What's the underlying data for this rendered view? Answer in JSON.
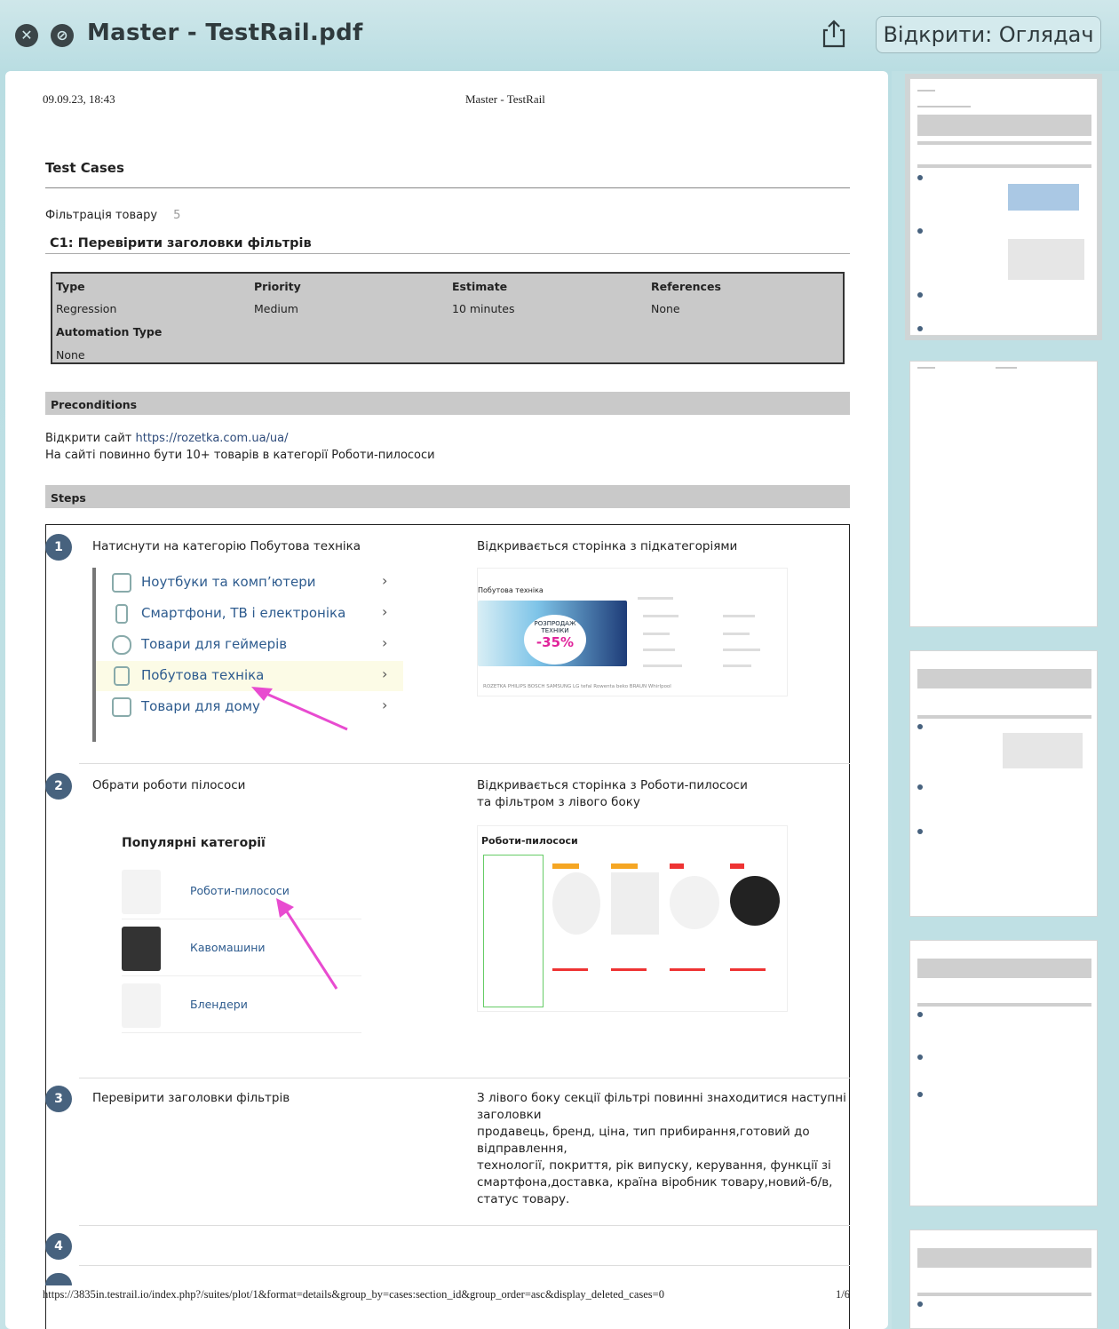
{
  "window": {
    "title": "Master - TestRail.pdf",
    "open_button": "Відкрити: Оглядач",
    "close_icon": "close-icon",
    "markup_icon": "markup-icon",
    "share_icon": "share-icon"
  },
  "page_header": {
    "date": "09.09.23, 18:43",
    "title": "Master - TestRail"
  },
  "doc": {
    "heading": "Test Cases",
    "section": "Фільтрація товару",
    "section_count": "5",
    "case_title": "C1: Перевірити заголовки фільтрів",
    "props": {
      "type_label": "Type",
      "type_value": "Regression",
      "priority_label": "Priority",
      "priority_value": "Medium",
      "estimate_label": "Estimate",
      "estimate_value": "10 minutes",
      "references_label": "References",
      "references_value": "None",
      "automation_label": "Automation Type",
      "automation_value": "None"
    },
    "preconditions_label": "Preconditions",
    "pre_line1_prefix": "Відкрити сайт ",
    "pre_line1_link": "https://rozetka.com.ua/ua/",
    "pre_line2": "На сайті повинно бути 10+ товарів в категорії Роботи-пилососи",
    "steps_label": "Steps",
    "steps": [
      {
        "num": "1",
        "action": "Натиснути на категорію Побутова техніка",
        "expected": "Відкривається сторінка з підкатегоріями"
      },
      {
        "num": "2",
        "action": "Обрати  роботи пілососи",
        "expected_l1": "Відкривається сторінка з Роботи-пилососи",
        "expected_l2": "та фільтром з лівого боку"
      },
      {
        "num": "3",
        "action": "Перевірити заголовки фільтрів",
        "expected_lines": [
          "З лівого боку секції фільтрі повинні знаходитися наступні",
          "заголовки",
          "продавець, бренд, ціна, тип прибирання,готовий до",
          "відправлення,",
          "технології, покриття, рік випуску, керування, функції зі",
          "смартфона,доставка, країна віробник товару,новий-б/в,",
          "статус товару."
        ]
      },
      {
        "num": "4"
      }
    ],
    "menu": [
      {
        "label": "Ноутбуки та комп’ютери",
        "icon": "laptop-icon"
      },
      {
        "label": "Смартфони, ТВ і електроніка",
        "icon": "phone-icon"
      },
      {
        "label": "Товари для геймерів",
        "icon": "gamepad-icon"
      },
      {
        "label": "Побутова техніка",
        "icon": "washer-icon"
      },
      {
        "label": "Товари для дому",
        "icon": "armchair-icon"
      }
    ],
    "shot1": {
      "title": "Побутова техніка",
      "banner_l1": "РОЗПРОДАЖ",
      "banner_l2": "ТЕХНІКИ",
      "banner_pct": "-35%",
      "brands": "ROZETKA   PHILIPS   BOSCH   SAMSUNG   LG   tefal   Rowenta   beko   BRAUN   Whirlpool"
    },
    "popular": {
      "heading": "Популярні категорії",
      "items": [
        "Роботи-пилососи",
        "Кавомашини",
        "Блендери"
      ]
    },
    "shot2": {
      "title": "Роботи-пилососи"
    }
  },
  "footer": {
    "url": "https://3835in.testrail.io/index.php?/suites/plot/1&format=details&group_by=cases:section_id&group_order=asc&display_deleted_cases=0",
    "page": "1/6"
  },
  "colors": {
    "step_badge": "#47627e",
    "link": "#2d5b8e",
    "annotation_arrow": "#e84bd0"
  }
}
